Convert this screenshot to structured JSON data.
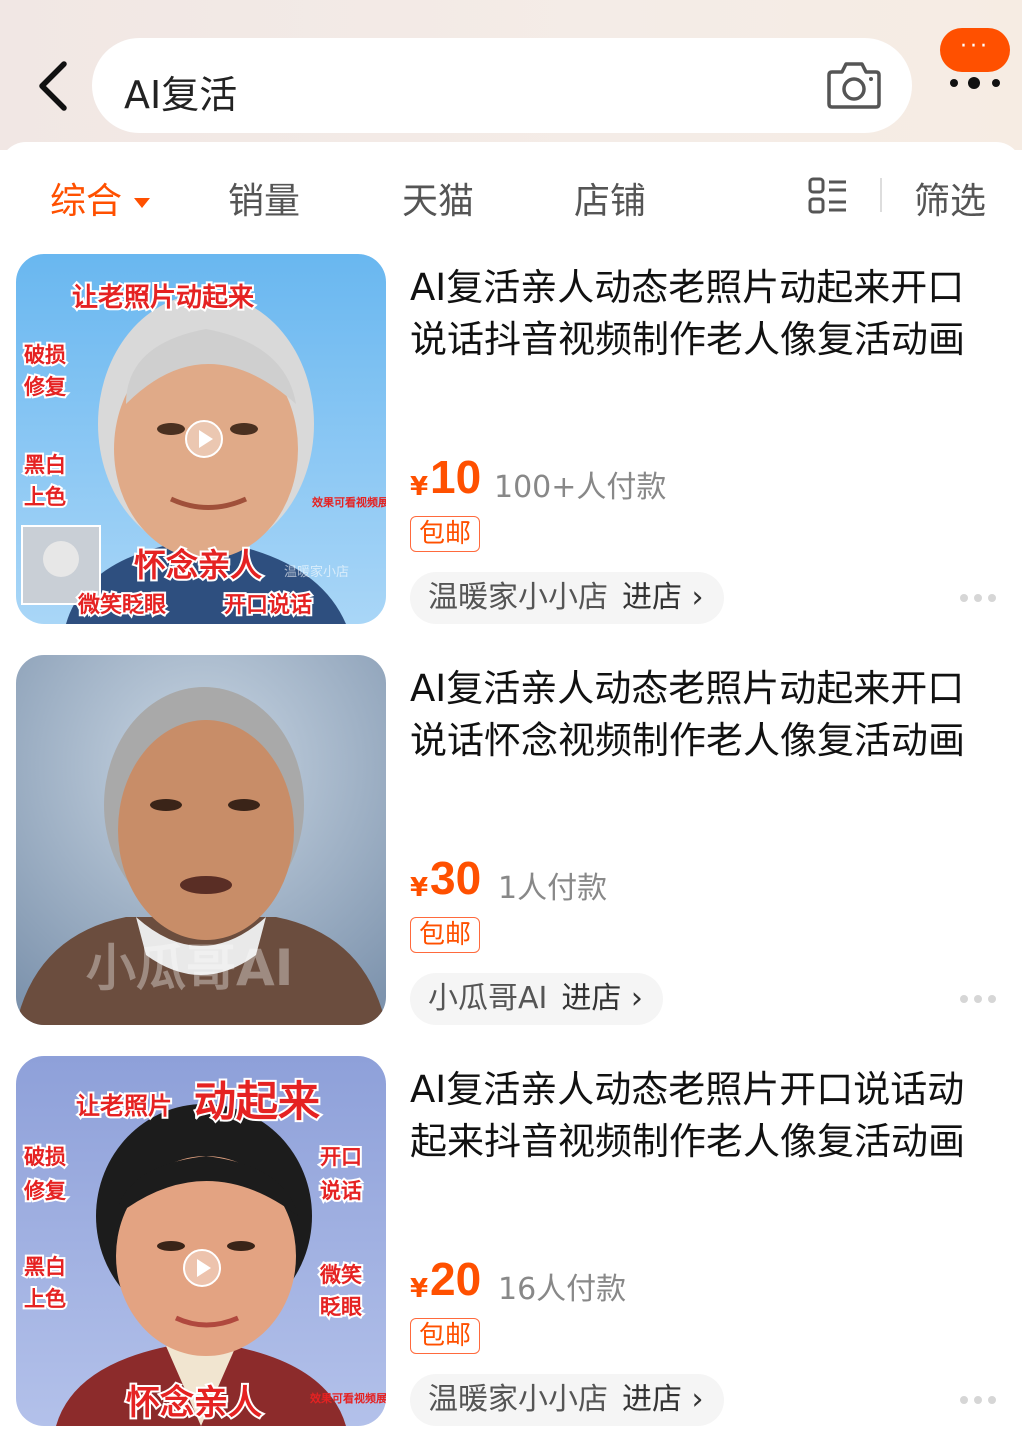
{
  "search": {
    "query": "AI复活"
  },
  "messages": {
    "badge": "···"
  },
  "sort_tabs": [
    "综合",
    "销量",
    "天猫",
    "店铺"
  ],
  "filter_label": "筛选",
  "products": [
    {
      "title": "AI复活亲人动态老照片动起来开口\n说话抖音视频制作老人像复活动画",
      "currency": "¥",
      "price": "10",
      "sales": "100+人付款",
      "shipping": "包邮",
      "shop": "温暖家小小店",
      "enter": "进店 ›",
      "image": {
        "top": "让老照片动起来",
        "left_labels": [
          "破损",
          "修复",
          "黑白",
          "上色"
        ],
        "demo": "效果可看视频展示",
        "caption_main": "怀念亲人",
        "caption_left": "微笑眨眼",
        "caption_right": "开口说话",
        "watermark": "温暖家小店"
      }
    },
    {
      "title": "AI复活亲人动态老照片动起来开口\n说话怀念视频制作老人像复活动画",
      "currency": "¥",
      "price": "30",
      "sales": "1人付款",
      "shipping": "包邮",
      "shop": "小瓜哥AI",
      "enter": "进店 ›",
      "image": {
        "watermark": "小瓜哥AI"
      }
    },
    {
      "title": "AI复活亲人动态老照片开口说话动\n起来抖音视频制作老人像复活动画",
      "currency": "¥",
      "price": "20",
      "sales": "16人付款",
      "shipping": "包邮",
      "shop": "温暖家小小店",
      "enter": "进店 ›",
      "image": {
        "top_small": "让老照片",
        "top_big": "动起来",
        "left_labels": [
          "破损",
          "修复",
          "黑白",
          "上色"
        ],
        "right_labels": [
          "开口",
          "说话",
          "微笑",
          "眨眼"
        ],
        "caption_main": "怀念亲人",
        "demo": "效果可看视频展示"
      }
    }
  ]
}
